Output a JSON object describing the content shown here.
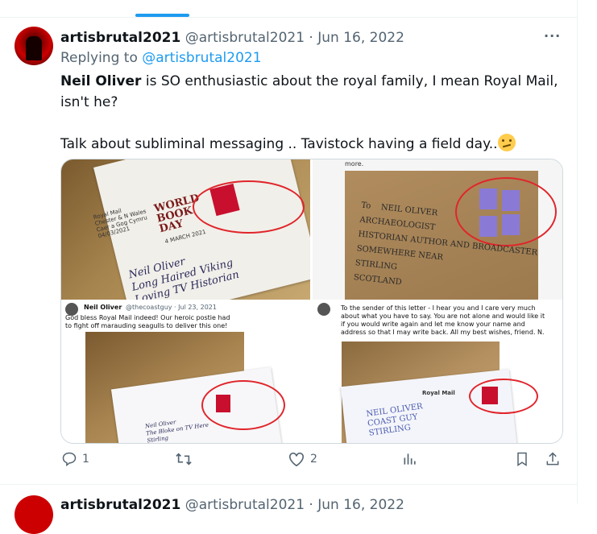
{
  "tweet": {
    "author_name": "artisbrutal2021",
    "author_handle": "@artisbrutal2021",
    "separator": " · ",
    "date": "Jun 16, 2022",
    "more": "···",
    "replying_prefix": "Replying to ",
    "replying_handle": "@artisbrutal2021",
    "text_bold": "Neil Oliver",
    "text_line1": " is SO enthusiastic about the royal family, I mean Royal Mail, isn't he?",
    "text_line2": "Talk about subliminal messaging .. Tavistock having a field day.."
  },
  "media": {
    "img1": {
      "small": "Royal Mail\nChester & N Wales\nCaer a Gog Cymru\n04/03/2021",
      "book": "WORLD\nBOOK\nDAY",
      "date": "4 MARCH 2021",
      "hand": "Neil Oliver\nLong Haired Viking\nLoving TV Historian"
    },
    "img2": {
      "top": "more.",
      "hand": "To    NEIL OLIVER\nARCHAEOLOGIST\nHISTORIAN AUTHOR AND BROADCASTER\nSOMEWHERE NEAR\nSTIRLING\nSCOTLAND"
    },
    "img3": {
      "name": "Neil Oliver",
      "handle": "@thecoastguy · Jul 23, 2021",
      "text": "God bless Royal Mail indeed! Our heroic postie had to fight off marauding seagulls to deliver this one!",
      "hand": "Neil Oliver\nThe Bloke on TV Here\nStirling"
    },
    "img4": {
      "text": "To the sender of this letter - I hear you and I care very much about what you have to say. You are not alone and would like it if you would write again and let me know your name and address so that I may write back. All my best wishes, friend. N.",
      "label": "Royal Mail",
      "hand": "NEIL OLIVER\nCOAST GUY\nSTIRLING"
    }
  },
  "actions": {
    "reply_count": "1",
    "retweet_count": "",
    "like_count": "2"
  },
  "next_tweet": {
    "author_name": "artisbrutal2021",
    "author_handle": "@artisbrutal2021",
    "date": "Jun 16, 2022"
  },
  "colors": {
    "accent": "#1d9bf0",
    "muted": "#536471",
    "circle": "#e0252b"
  }
}
